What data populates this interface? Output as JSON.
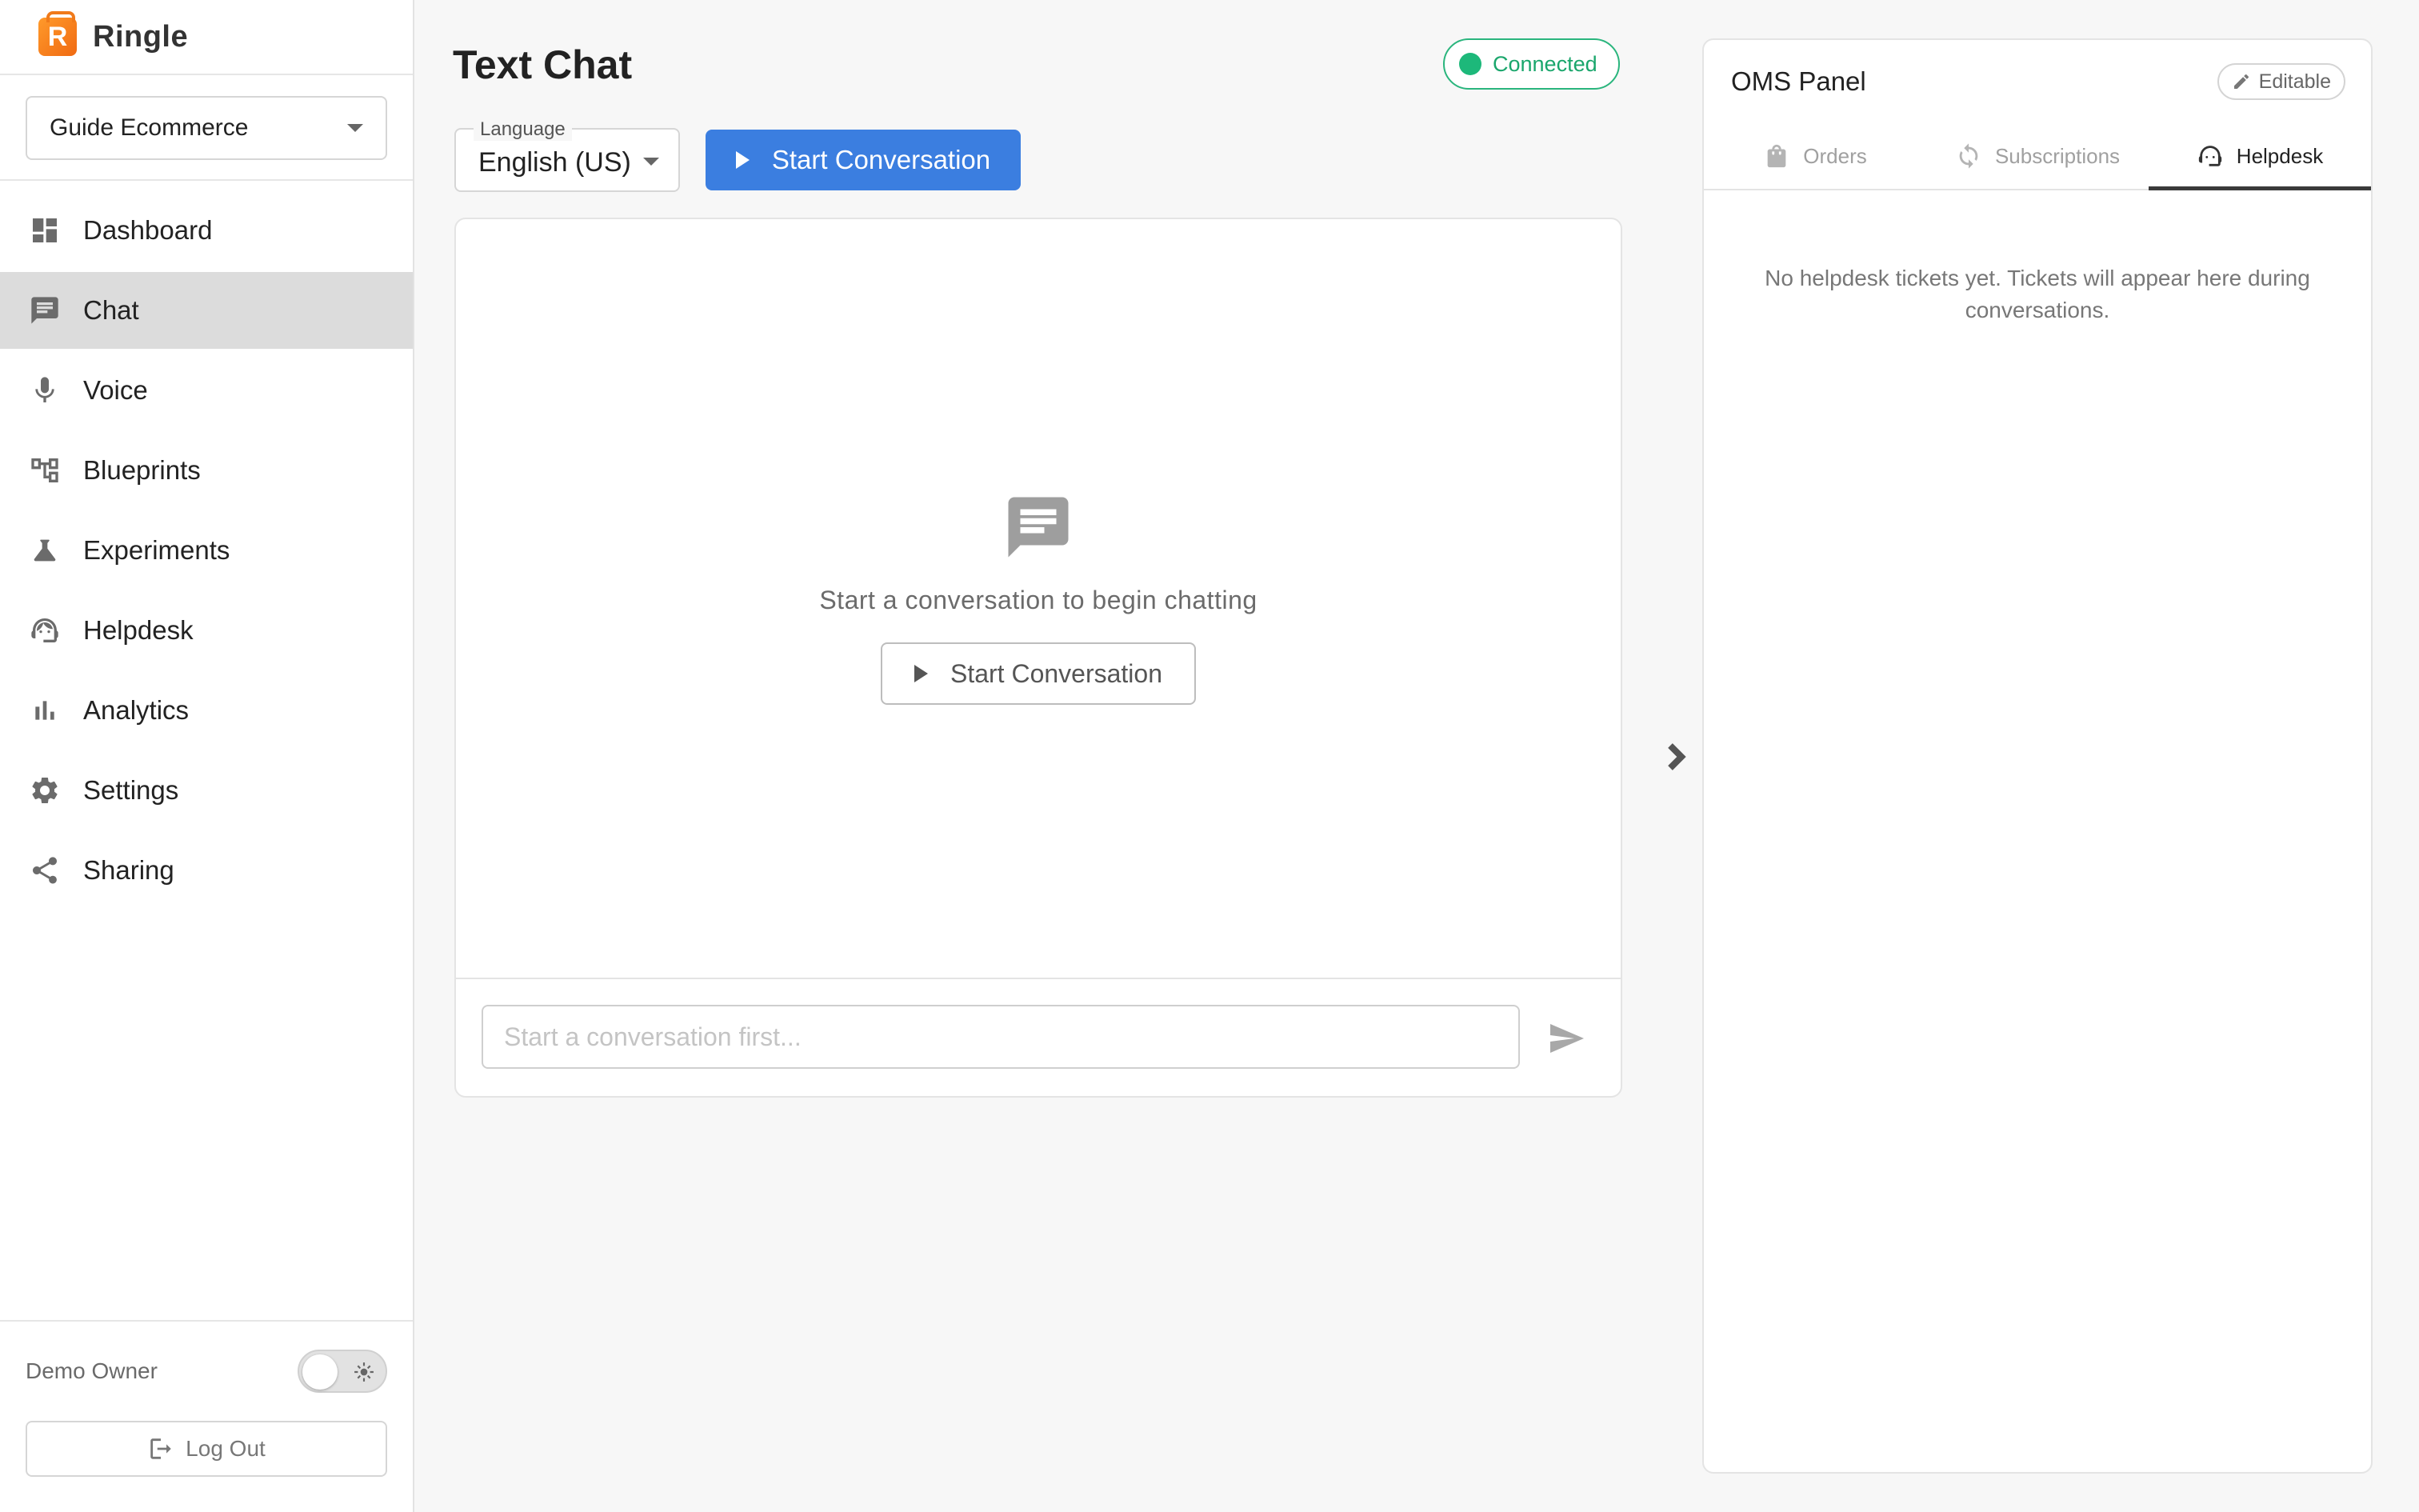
{
  "brand": {
    "name": "Ringle",
    "logo_letter": "R"
  },
  "workspace": {
    "selected": "Guide Ecommerce"
  },
  "sidebar": {
    "items": [
      {
        "label": "Dashboard",
        "icon": "dashboard-icon"
      },
      {
        "label": "Chat",
        "icon": "chat-icon",
        "active": true
      },
      {
        "label": "Voice",
        "icon": "mic-icon"
      },
      {
        "label": "Blueprints",
        "icon": "blueprint-icon"
      },
      {
        "label": "Experiments",
        "icon": "flask-icon"
      },
      {
        "label": "Helpdesk",
        "icon": "headset-icon"
      },
      {
        "label": "Analytics",
        "icon": "bar-chart-icon"
      },
      {
        "label": "Settings",
        "icon": "gear-icon"
      },
      {
        "label": "Sharing",
        "icon": "share-icon"
      }
    ],
    "owner": "Demo Owner",
    "logout_label": "Log Out"
  },
  "main": {
    "title": "Text Chat",
    "status": "Connected",
    "language": {
      "label": "Language",
      "value": "English (US)"
    },
    "start_button": "Start Conversation",
    "empty_text": "Start a conversation to begin chatting",
    "empty_button": "Start Conversation",
    "input_placeholder": "Start a conversation first..."
  },
  "oms": {
    "title": "OMS Panel",
    "editable_label": "Editable",
    "tabs": [
      {
        "label": "Orders",
        "icon": "bag-icon"
      },
      {
        "label": "Subscriptions",
        "icon": "refresh-icon"
      },
      {
        "label": "Helpdesk",
        "icon": "headset-icon",
        "active": true
      }
    ],
    "empty_text": "No helpdesk tickets yet. Tickets will appear here during conversations."
  },
  "colors": {
    "primary": "#3b7ee0",
    "connected": "#1db87a",
    "brand_orange": "#f07a1a"
  }
}
